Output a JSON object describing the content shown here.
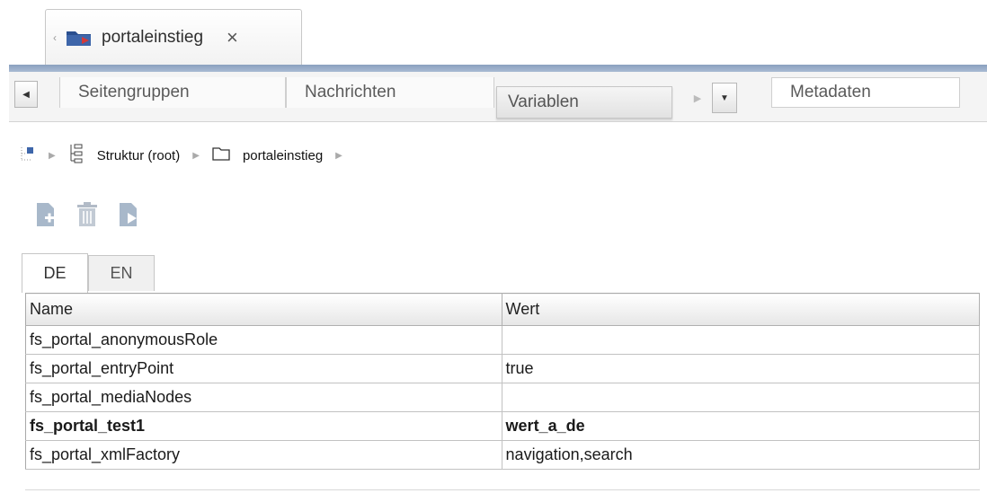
{
  "window": {
    "doc_tab_title": "portaleinstieg",
    "close_glyph": "×",
    "scroll_left_glyph": "‹"
  },
  "subtabs": {
    "nav_left_glyph": "◀",
    "nav_right_glyph": "▶",
    "dropdown_glyph": "▼",
    "items": [
      {
        "label": "Seitengruppen"
      },
      {
        "label": "Nachrichten"
      },
      {
        "label": "Variablen",
        "active": true
      },
      {
        "label": "Metadaten"
      }
    ]
  },
  "breadcrumb": {
    "sep": "▶",
    "root_label": "Struktur (root)",
    "folder_label": "portaleinstieg"
  },
  "toolbar": {
    "buttons": [
      "add-variable-icon",
      "delete-icon",
      "edit-variable-icon"
    ]
  },
  "languages": {
    "de": "DE",
    "en": "EN",
    "active": "DE"
  },
  "table": {
    "headers": [
      "Name",
      "Wert"
    ],
    "rows": [
      {
        "name": "fs_portal_anonymousRole",
        "value": "",
        "bold": false
      },
      {
        "name": "fs_portal_entryPoint",
        "value": "true",
        "bold": false
      },
      {
        "name": "fs_portal_mediaNodes",
        "value": "",
        "bold": false
      },
      {
        "name": "fs_portal_test1",
        "value": "wert_a_de",
        "bold": true
      },
      {
        "name": "fs_portal_xmlFactory",
        "value": "navigation,search",
        "bold": false
      }
    ]
  },
  "colors": {
    "accent_bar": "#8aa0bf",
    "folder_blue": "#2a4f8f",
    "icon_gray": "#6f8aa8"
  }
}
